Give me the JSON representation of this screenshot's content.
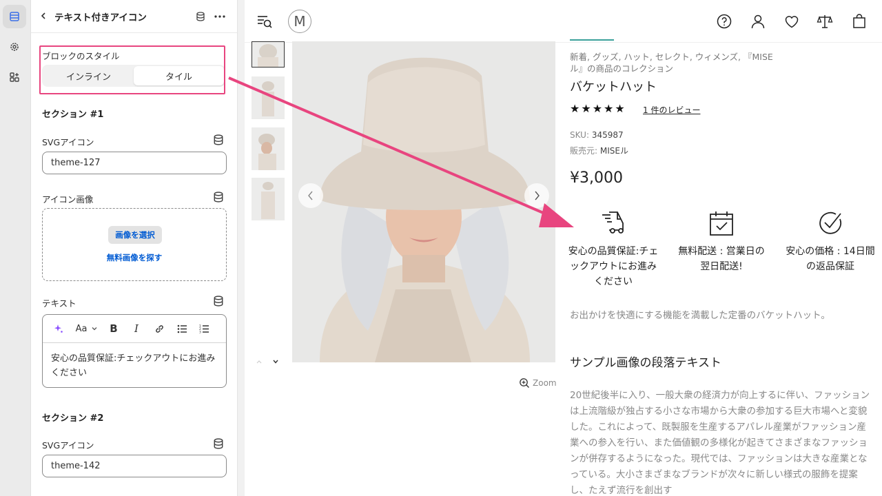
{
  "panel": {
    "title": "テキスト付きアイコン",
    "block_style_label": "ブロックのスタイル",
    "style_options": [
      "インライン",
      "タイル"
    ],
    "selected_style": "タイル",
    "section1": {
      "heading": "セクション #1",
      "svg_label": "SVGアイコン",
      "svg_value": "theme-127",
      "image_label": "アイコン画像",
      "select_image": "画像を選択",
      "free_images": "無料画像を探す",
      "text_label": "テキスト",
      "text_value": "安心の品質保証:チェックアウトにお進みください"
    },
    "section2": {
      "heading": "セクション #2",
      "svg_label": "SVGアイコン",
      "svg_value": "theme-142"
    },
    "rte_font_label": "Aa"
  },
  "product": {
    "logo": "M",
    "collections": "新着, グッズ, ハット, セレクト, ウィメンズ, 『MISEル』の商品のコレクション",
    "title": "バケットハット",
    "stars": "★★★★★",
    "rating": 5,
    "reviews": "1 件のレビュー",
    "sku_label": "SKU:",
    "sku": "345987",
    "vendor_label": "販売元:",
    "vendor": "MISEル",
    "price": "¥3,000",
    "features": [
      {
        "icon": "delivery-truck-icon",
        "text": "安心の品質保証:チェックアウトにお進みください"
      },
      {
        "icon": "calendar-check-icon",
        "text": "無料配送 : 営業日の翌日配送!"
      },
      {
        "icon": "check-circle-icon",
        "text": "安心の価格 : 14日間の返品保証"
      }
    ],
    "description": "お出かけを快適にする機能を満載した定番のバケットハット。",
    "section_heading": "サンプル画像の段落テキスト",
    "paragraph": "20世紀後半に入り、一般大衆の経済力が向上するに伴い、ファッションは上流階級が独占する小さな市場から大衆の参加する巨大市場へと変貌した。これによって、既製服を生産するアパレル産業がファッション産業への参入を行い、また価値観の多様化が起きてさまざまなファッションが併存するようになった。現代では、ファッションは大きな産業となっている。大小さまざまなブランドが次々に新しい様式の服飾を提案し、たえず流行を創出す",
    "zoom": "Zoom"
  },
  "colors": {
    "highlight": "#e8457f",
    "link": "#005bd3",
    "accent": "#3aa09a"
  }
}
